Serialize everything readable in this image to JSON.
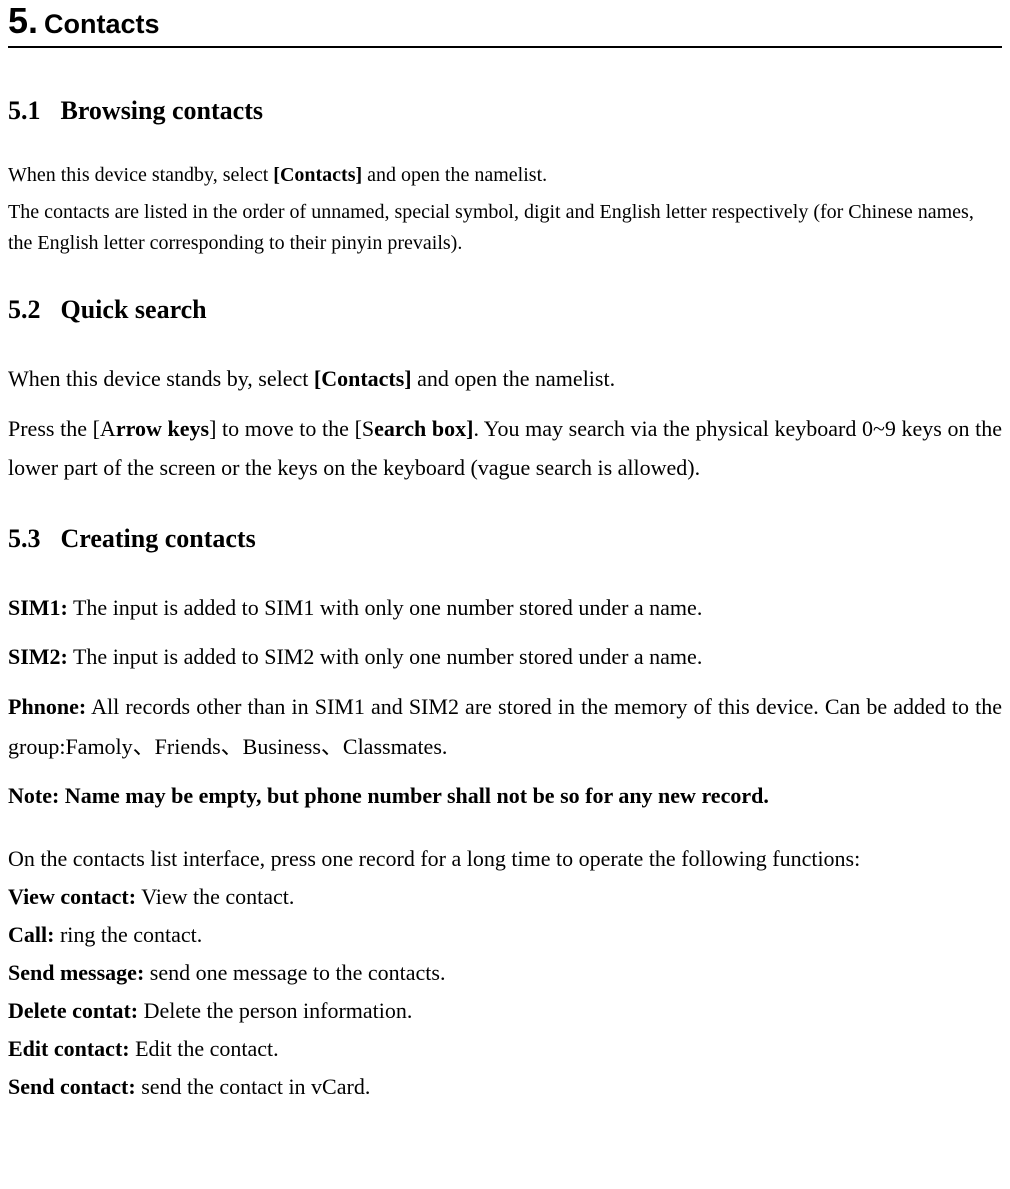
{
  "chapter": {
    "number": "5.",
    "title": "Contacts"
  },
  "sections": {
    "s51": {
      "num": "5.1",
      "title": "Browsing contacts",
      "p1_a": "When this device standby, select ",
      "p1_b": "[Contacts]",
      "p1_c": " and open the namelist.",
      "p2": "The contacts are listed in the order of unnamed, special symbol, digit and English letter respectively (for Chinese names, the English letter corresponding to their pinyin prevails)."
    },
    "s52": {
      "num": "5.2",
      "title": "Quick search",
      "p1_a": "When this device stands by, select ",
      "p1_b": "[Contacts]",
      "p1_c": " and open the namelist.",
      "p2_a": "Press the [A",
      "p2_b": "rrow keys",
      "p2_c": "] to move to the [S",
      "p2_d": "earch box]",
      "p2_e": ". You may search via the physical keyboard 0~9 keys on the lower part of the screen or the keys on the keyboard (vague search is allowed)."
    },
    "s53": {
      "num": "5.3",
      "title": "Creating contacts",
      "sim1_label": "SIM1:",
      "sim1_text": " The input is added to SIM1 with only one number stored under a name.",
      "sim2_label": "SIM2:",
      "sim2_text": " The input is added to SIM2 with only one number stored under a name.",
      "phone_label": "Phnone:",
      "phone_text": " All records other than in SIM1 and SIM2 are stored in the memory of this device. Can be added to the group:Famoly、Friends、Business、Classmates.",
      "note": "Note: Name may be empty, but phone number shall not be so for any new record.",
      "longpress_intro": "On the contacts list interface, press one record for a long time to operate the following functions:",
      "functions": [
        {
          "label": "View contact:",
          "desc": " View the contact."
        },
        {
          "label": "Call:",
          "desc": " ring the contact."
        },
        {
          "label": "Send message:",
          "desc": " send one message to the contacts."
        },
        {
          "label": "Delete contat:",
          "desc": " Delete the person information."
        },
        {
          "label": "Edit contact:",
          "desc": " Edit the contact."
        },
        {
          "label": "Send contact:",
          "desc": " send the contact in vCard."
        }
      ]
    }
  }
}
